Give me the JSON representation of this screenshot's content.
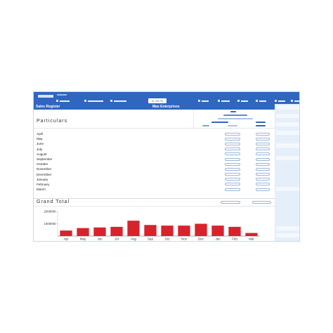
{
  "header": {
    "goto_label": "G: Go To",
    "report_title": "Sales Register",
    "company_name": "Max Enterprises"
  },
  "columns": {
    "particulars_label": "Particulars"
  },
  "months": [
    "April",
    "May",
    "June",
    "July",
    "August",
    "September",
    "October",
    "November",
    "December",
    "January",
    "February",
    "March"
  ],
  "grand_total": {
    "label": "Grand Total"
  },
  "colors": {
    "header_blue": "#2f66bf",
    "bar_red": "#d9232b",
    "panel_light_blue": "#e4effa"
  },
  "chart_data": {
    "type": "bar",
    "categories": [
      "Apr",
      "May",
      "Jun",
      "Jul",
      "Aug",
      "Sep",
      "Oct",
      "Nov",
      "Dec",
      "Jan",
      "Feb",
      "Mar"
    ],
    "values": [
      450000,
      650000,
      700000,
      750000,
      1250000,
      900000,
      850000,
      850000,
      1000000,
      850000,
      750000,
      250000
    ],
    "yticks": [
      "2000000",
      "1000000"
    ],
    "ylim": [
      0,
      2000000
    ],
    "title": "",
    "xlabel": "",
    "ylabel": ""
  }
}
